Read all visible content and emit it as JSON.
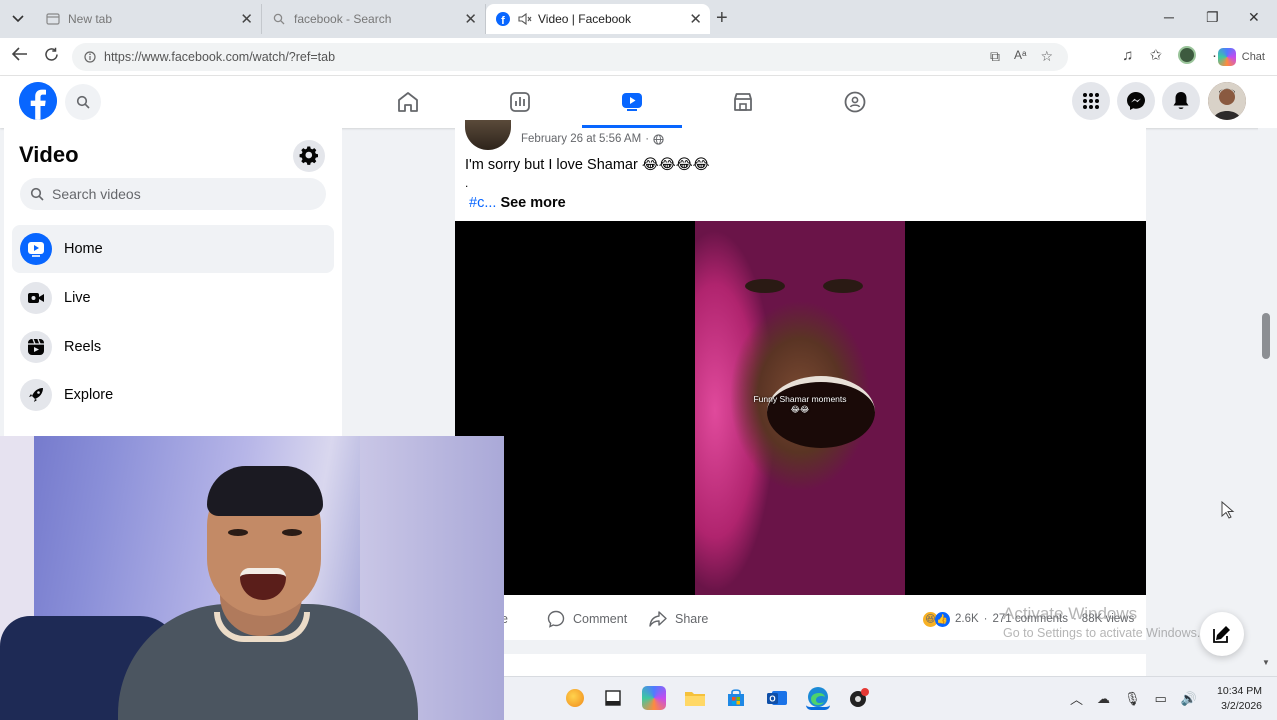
{
  "browser": {
    "tabs": [
      {
        "title": "New tab",
        "active": false
      },
      {
        "title": "facebook - Search",
        "active": false
      },
      {
        "title": "Video | Facebook",
        "active": true
      }
    ],
    "url": "https://www.facebook.com/watch/?ref=tab",
    "copilot_label": "Chat"
  },
  "colors": {
    "brand": "#0866ff",
    "page_bg": "#f0f2f5",
    "secondary_text": "#65676b"
  },
  "fb_nav": {
    "items": [
      {
        "name": "home-icon",
        "active": false
      },
      {
        "name": "dashboard-icon",
        "active": false
      },
      {
        "name": "video-icon",
        "active": true
      },
      {
        "name": "marketplace-icon",
        "active": false
      },
      {
        "name": "groups-icon",
        "active": false
      }
    ]
  },
  "sidebar": {
    "title": "Video",
    "search_placeholder": "Search videos",
    "items": [
      {
        "label": "Home",
        "icon": "play-icon",
        "active": true
      },
      {
        "label": "Live",
        "icon": "live-camera-icon",
        "active": false
      },
      {
        "label": "Reels",
        "icon": "reels-icon",
        "active": false
      },
      {
        "label": "Explore",
        "icon": "rocket-icon",
        "active": false
      }
    ]
  },
  "post": {
    "timestamp": "February 26 at 5:56 AM",
    "separator": "·",
    "text": "I'm sorry but I love Shamar 😂😂😂😂",
    "dot": ".",
    "hashtag": "#c...",
    "see_more": "See more",
    "video_caption": "Funny Shamar moments",
    "video_caption_emoji": "😂😂",
    "like_label": "Like",
    "comment_label": "Comment",
    "share_label": "Share",
    "reaction_count": "2.6K",
    "comments": "271 comments",
    "views": "88K views"
  },
  "watermark": {
    "line1": "Activate Windows",
    "line2": "Go to Settings to activate Windows."
  },
  "taskbar": {
    "time": "10:34 PM",
    "date": "3/2/2026"
  }
}
